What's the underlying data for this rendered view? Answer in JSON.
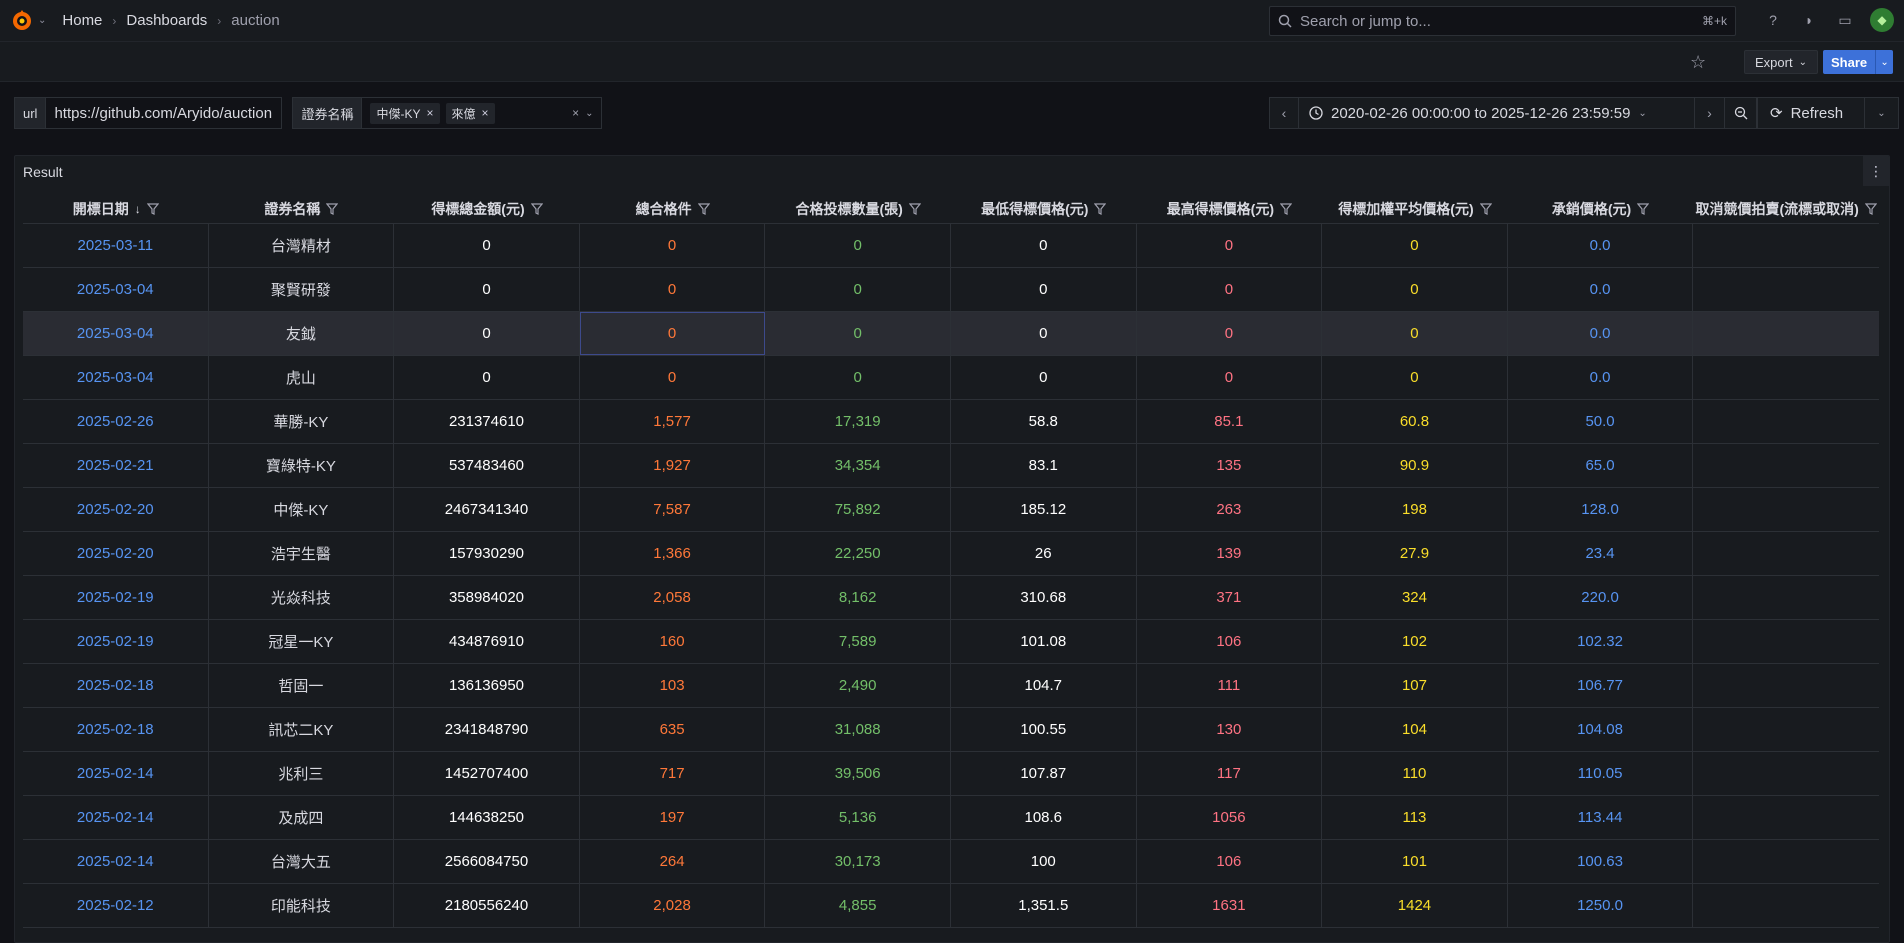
{
  "header": {
    "breadcrumbs": [
      "Home",
      "Dashboards",
      "auction"
    ],
    "search_placeholder": "Search or jump to...",
    "search_shortcut": "⌘+k"
  },
  "toolbar": {
    "export_label": "Export",
    "share_label": "Share"
  },
  "variables": {
    "url_label": "url",
    "url_value": "https://github.com/Aryido/auction",
    "security_label": "證券名稱",
    "security_chips": [
      "中傑-KY",
      "來億"
    ]
  },
  "timepicker": {
    "range": "2020-02-26 00:00:00 to 2025-12-26 23:59:59",
    "refresh_label": "Refresh"
  },
  "panel": {
    "title": "Result",
    "columns": [
      "開標日期",
      "證券名稱",
      "得標總金額(元)",
      "總合格件",
      "合格投標數量(張)",
      "最低得標價格(元)",
      "最高得標價格(元)",
      "得標加權平均價格(元)",
      "承銷價格(元)",
      "取消競價拍賣(流標或取消)"
    ],
    "rows": [
      [
        "2025-03-11",
        "台灣精材",
        "0",
        "0",
        "0",
        "0",
        "0",
        "0",
        "0.0",
        ""
      ],
      [
        "2025-03-04",
        "聚賢研發",
        "0",
        "0",
        "0",
        "0",
        "0",
        "0",
        "0.0",
        ""
      ],
      [
        "2025-03-04",
        "友鉞",
        "0",
        "0",
        "0",
        "0",
        "0",
        "0",
        "0.0",
        ""
      ],
      [
        "2025-03-04",
        "虎山",
        "0",
        "0",
        "0",
        "0",
        "0",
        "0",
        "0.0",
        ""
      ],
      [
        "2025-02-26",
        "華勝-KY",
        "231374610",
        "1,577",
        "17,319",
        "58.8",
        "85.1",
        "60.8",
        "50.0",
        ""
      ],
      [
        "2025-02-21",
        "寶綠特-KY",
        "537483460",
        "1,927",
        "34,354",
        "83.1",
        "135",
        "90.9",
        "65.0",
        ""
      ],
      [
        "2025-02-20",
        "中傑-KY",
        "2467341340",
        "7,587",
        "75,892",
        "185.12",
        "263",
        "198",
        "128.0",
        ""
      ],
      [
        "2025-02-20",
        "浩宇生醫",
        "157930290",
        "1,366",
        "22,250",
        "26",
        "139",
        "27.9",
        "23.4",
        ""
      ],
      [
        "2025-02-19",
        "光焱科技",
        "358984020",
        "2,058",
        "8,162",
        "310.68",
        "371",
        "324",
        "220.0",
        ""
      ],
      [
        "2025-02-19",
        "冠星一KY",
        "434876910",
        "160",
        "7,589",
        "101.08",
        "106",
        "102",
        "102.32",
        ""
      ],
      [
        "2025-02-18",
        "哲固一",
        "136136950",
        "103",
        "2,490",
        "104.7",
        "111",
        "107",
        "106.77",
        ""
      ],
      [
        "2025-02-18",
        "訊芯二KY",
        "2341848790",
        "635",
        "31,088",
        "100.55",
        "130",
        "104",
        "104.08",
        ""
      ],
      [
        "2025-02-14",
        "兆利三",
        "1452707400",
        "717",
        "39,506",
        "107.87",
        "117",
        "110",
        "110.05",
        ""
      ],
      [
        "2025-02-14",
        "及成四",
        "144638250",
        "197",
        "5,136",
        "108.6",
        "1056",
        "113",
        "113.44",
        ""
      ],
      [
        "2025-02-14",
        "台灣大五",
        "2566084750",
        "264",
        "30,173",
        "100",
        "106",
        "101",
        "100.63",
        ""
      ],
      [
        "2025-02-12",
        "印能科技",
        "2180556240",
        "2,028",
        "4,855",
        "1,351.5",
        "1631",
        "1424",
        "1250.0",
        ""
      ]
    ]
  },
  "colors": {
    "date": "#5794f2",
    "count": "#ff7839",
    "qty": "#73bf69",
    "max": "#ff7383",
    "avg": "#fade2a",
    "accent": "#3d71d9"
  }
}
